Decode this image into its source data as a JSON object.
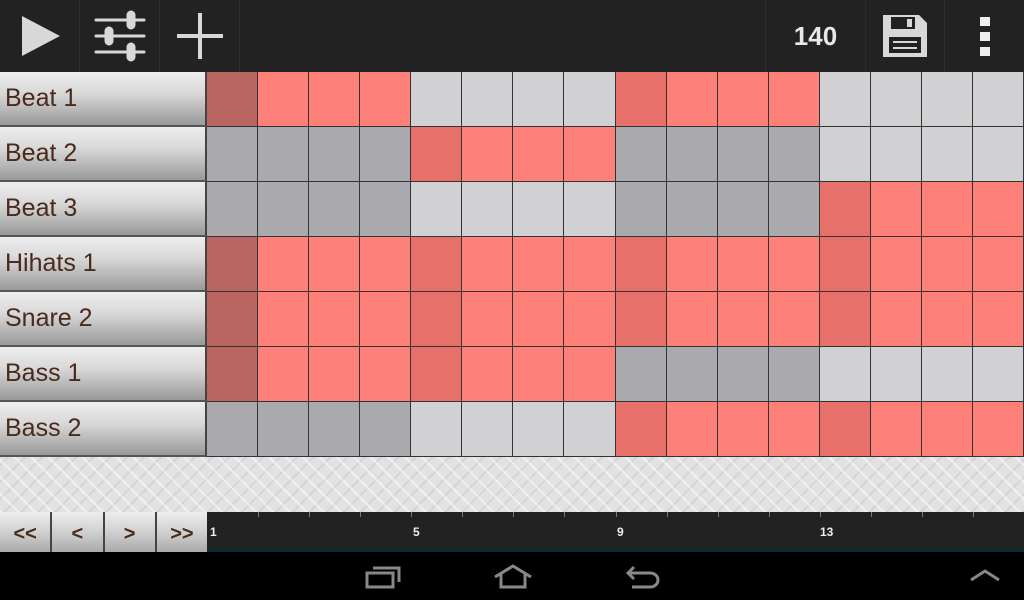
{
  "toolbar": {
    "play_icon": "play-icon",
    "mixer_icon": "sliders-icon",
    "add_icon": "plus-icon",
    "bpm": "140",
    "save_icon": "floppy-disk-icon",
    "menu_icon": "overflow-menu-icon"
  },
  "colors": {
    "active": "#fd8179",
    "active_beat": "#e8706a",
    "active_playhead": "#b96662",
    "inactive_dark": "#aaa9ad",
    "inactive_light": "#d1d1d3"
  },
  "current_step": 1,
  "tracks": [
    {
      "label": "Beat 1",
      "steps": [
        1,
        1,
        1,
        1,
        0,
        0,
        0,
        0,
        1,
        1,
        1,
        1,
        0,
        0,
        0,
        0
      ]
    },
    {
      "label": "Beat 2",
      "steps": [
        0,
        0,
        0,
        0,
        1,
        1,
        1,
        1,
        0,
        0,
        0,
        0,
        0,
        0,
        0,
        0
      ]
    },
    {
      "label": "Beat 3",
      "steps": [
        0,
        0,
        0,
        0,
        0,
        0,
        0,
        0,
        0,
        0,
        0,
        0,
        1,
        1,
        1,
        1
      ]
    },
    {
      "label": "Hihats 1",
      "steps": [
        1,
        1,
        1,
        1,
        1,
        1,
        1,
        1,
        1,
        1,
        1,
        1,
        1,
        1,
        1,
        1
      ]
    },
    {
      "label": "Snare 2",
      "steps": [
        1,
        1,
        1,
        1,
        1,
        1,
        1,
        1,
        1,
        1,
        1,
        1,
        1,
        1,
        1,
        1
      ]
    },
    {
      "label": "Bass 1",
      "steps": [
        1,
        1,
        1,
        1,
        1,
        1,
        1,
        1,
        0,
        0,
        0,
        0,
        0,
        0,
        0,
        0
      ]
    },
    {
      "label": "Bass 2",
      "steps": [
        0,
        0,
        0,
        0,
        0,
        0,
        0,
        0,
        1,
        1,
        1,
        1,
        1,
        1,
        1,
        1
      ]
    }
  ],
  "nav": {
    "first": "<<",
    "prev": "<",
    "next": ">",
    "last": ">>"
  },
  "timeline": {
    "labels": [
      "1",
      "5",
      "9",
      "13"
    ]
  },
  "system": {
    "recents_icon": "recent-apps-icon",
    "home_icon": "home-icon",
    "back_icon": "back-icon",
    "up_icon": "chevron-up-icon"
  }
}
